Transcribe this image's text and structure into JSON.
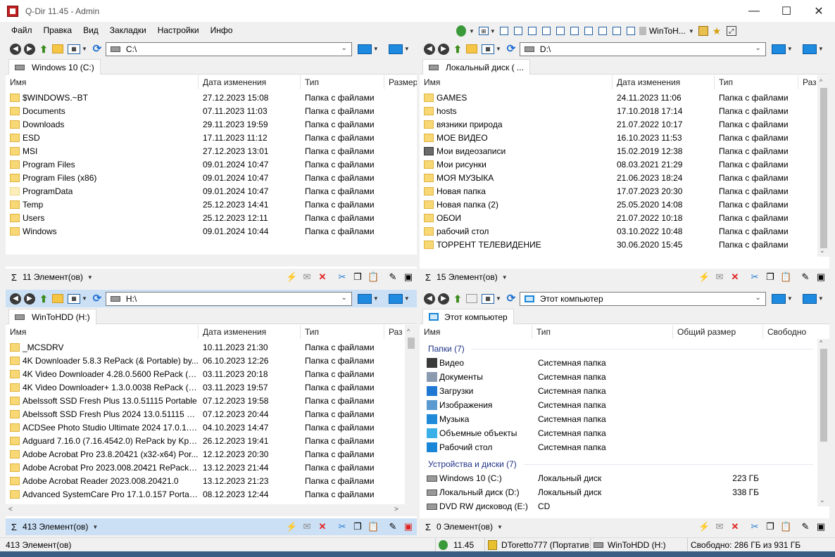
{
  "window": {
    "title": "Q-Dir 11.45 - Admin",
    "minimize": "—",
    "maximize": "☐",
    "close": "✕"
  },
  "menu": [
    "Файл",
    "Правка",
    "Вид",
    "Закладки",
    "Настройки",
    "Инфо"
  ],
  "toolbar_top": {
    "wintohdd_label": "WinToH..."
  },
  "pane_tl": {
    "address": "C:\\",
    "tab": "Windows 10 (C:)",
    "headers": [
      "Имя",
      "Дата изменения",
      "Тип",
      "Размер"
    ],
    "rows": [
      {
        "name": "$WINDOWS.~BT",
        "date": "27.12.2023 15:08",
        "type": "Папка с файлами",
        "pale": false
      },
      {
        "name": "Documents",
        "date": "07.11.2023 11:03",
        "type": "Папка с файлами",
        "pale": false
      },
      {
        "name": "Downloads",
        "date": "29.11.2023 19:59",
        "type": "Папка с файлами",
        "pale": false
      },
      {
        "name": "ESD",
        "date": "17.11.2023 11:12",
        "type": "Папка с файлами",
        "pale": false
      },
      {
        "name": "MSI",
        "date": "27.12.2023 13:01",
        "type": "Папка с файлами",
        "pale": false
      },
      {
        "name": "Program Files",
        "date": "09.01.2024 10:47",
        "type": "Папка с файлами",
        "pale": false
      },
      {
        "name": "Program Files (x86)",
        "date": "09.01.2024 10:47",
        "type": "Папка с файлами",
        "pale": false
      },
      {
        "name": "ProgramData",
        "date": "09.01.2024 10:47",
        "type": "Папка с файлами",
        "pale": true
      },
      {
        "name": "Temp",
        "date": "25.12.2023 14:41",
        "type": "Папка с файлами",
        "pale": false
      },
      {
        "name": "Users",
        "date": "25.12.2023 12:11",
        "type": "Папка с файлами",
        "pale": false
      },
      {
        "name": "Windows",
        "date": "09.01.2024 10:44",
        "type": "Папка с файлами",
        "pale": false
      }
    ],
    "status": "11 Элемент(ов)"
  },
  "pane_tr": {
    "address": "D:\\",
    "tab": "Локальный диск ( ...",
    "headers": [
      "Имя",
      "Дата изменения",
      "Тип",
      "Раз"
    ],
    "rows": [
      {
        "name": "GAMES",
        "date": "24.11.2023 11:06",
        "type": "Папка с файлами",
        "vid": false
      },
      {
        "name": "hosts",
        "date": "17.10.2018 17:14",
        "type": "Папка с файлами",
        "vid": false
      },
      {
        "name": "вязники природа",
        "date": "21.07.2022 10:17",
        "type": "Папка с файлами",
        "vid": false
      },
      {
        "name": "МОЕ ВИДЕО",
        "date": "16.10.2023 11:53",
        "type": "Папка с файлами",
        "vid": false
      },
      {
        "name": "Мои видеозаписи",
        "date": "15.02.2019 12:38",
        "type": "Папка с файлами",
        "vid": true
      },
      {
        "name": "Мои рисунки",
        "date": "08.03.2021 21:29",
        "type": "Папка с файлами",
        "vid": false
      },
      {
        "name": "МОЯ МУЗЫКА",
        "date": "21.06.2023 18:24",
        "type": "Папка с файлами",
        "vid": false
      },
      {
        "name": "Новая папка",
        "date": "17.07.2023 20:30",
        "type": "Папка с файлами",
        "vid": false
      },
      {
        "name": "Новая папка (2)",
        "date": "25.05.2020 14:08",
        "type": "Папка с файлами",
        "vid": false
      },
      {
        "name": "ОБОИ",
        "date": "21.07.2022 10:18",
        "type": "Папка с файлами",
        "vid": false
      },
      {
        "name": "рабочий стол",
        "date": "03.10.2022 10:48",
        "type": "Папка с файлами",
        "vid": false
      },
      {
        "name": "ТОРРЕНТ ТЕЛЕВИДЕНИЕ",
        "date": "30.06.2020 15:45",
        "type": "Папка с файлами",
        "vid": false
      }
    ],
    "status": "15 Элемент(ов)"
  },
  "pane_bl": {
    "address": "H:\\",
    "tab": "WinToHDD (H:)",
    "headers": [
      "Имя",
      "Дата изменения",
      "Тип",
      "Раз"
    ],
    "rows": [
      {
        "name": "_MCSDRV",
        "date": "10.11.2023 21:30",
        "type": "Папка с файлами"
      },
      {
        "name": "4K Downloader 5.8.3 RePack (& Portable) by...",
        "date": "06.10.2023 12:26",
        "type": "Папка с файлами"
      },
      {
        "name": "4K Video Downloader 4.28.0.5600 RePack (&...",
        "date": "03.11.2023 20:18",
        "type": "Папка с файлами"
      },
      {
        "name": "4K Video Downloader+ 1.3.0.0038 RePack (&...",
        "date": "03.11.2023 19:57",
        "type": "Папка с файлами"
      },
      {
        "name": "Abelssoft SSD Fresh Plus 13.0.51115 Portable",
        "date": "07.12.2023 19:58",
        "type": "Папка с файлами"
      },
      {
        "name": "Abelssoft SSD Fresh Plus 2024 13.0.51115 Por...",
        "date": "07.12.2023 20:44",
        "type": "Папка с файлами"
      },
      {
        "name": "ACDSee Photo Studio Ultimate 2024 17.0.1.3...",
        "date": "04.10.2023 14:47",
        "type": "Папка с файлами"
      },
      {
        "name": "Adguard 7.16.0 (7.16.4542.0) RePack by KpoJ...",
        "date": "26.12.2023 19:41",
        "type": "Папка с файлами"
      },
      {
        "name": "Adobe Acrobat Pro 23.8.20421 (x32-x64) Por...",
        "date": "12.12.2023 20:30",
        "type": "Папка с файлами"
      },
      {
        "name": "Adobe Acrobat Pro 2023.008.20421 RePack b...",
        "date": "13.12.2023 21:44",
        "type": "Папка с файлами"
      },
      {
        "name": "Adobe Acrobat Reader 2023.008.20421.0",
        "date": "13.12.2023 21:23",
        "type": "Папка с файлами"
      },
      {
        "name": "Advanced SystemCare Pro 17.1.0.157 Portab...",
        "date": "08.12.2023 12:44",
        "type": "Папка с файлами"
      }
    ],
    "status": "413 Элемент(ов)"
  },
  "pane_br": {
    "address": "Этот компьютер",
    "tab": "Этот компьютер",
    "headers": [
      "Имя",
      "Тип",
      "Общий размер",
      "Свободно"
    ],
    "group1": "Папки (7)",
    "folders": [
      {
        "name": "Видео",
        "type": "Системная папка",
        "icon": "video-folder-icon",
        "color": "#3a3a3a"
      },
      {
        "name": "Документы",
        "type": "Системная папка",
        "icon": "documents-folder-icon",
        "color": "#8a9bb0"
      },
      {
        "name": "Загрузки",
        "type": "Системная папка",
        "icon": "downloads-folder-icon",
        "color": "#1e78d4"
      },
      {
        "name": "Изображения",
        "type": "Системная папка",
        "icon": "pictures-folder-icon",
        "color": "#5a9ad0"
      },
      {
        "name": "Музыка",
        "type": "Системная папка",
        "icon": "music-folder-icon",
        "color": "#1f8ad8"
      },
      {
        "name": "Объемные объекты",
        "type": "Системная папка",
        "icon": "3d-objects-folder-icon",
        "color": "#3ab0e8"
      },
      {
        "name": "Рабочий стол",
        "type": "Системная папка",
        "icon": "desktop-folder-icon",
        "color": "#1a86d8"
      }
    ],
    "group2": "Устройства и диски (7)",
    "drives": [
      {
        "name": "Windows 10 (C:)",
        "type": "Локальный диск",
        "size": "223 ГБ"
      },
      {
        "name": "Локальный диск (D:)",
        "type": "Локальный диск",
        "size": "338 ГБ"
      },
      {
        "name": "DVD RW дисковод (E:)",
        "type": "CD",
        "size": ""
      }
    ],
    "status": "0 Элемент(ов)"
  },
  "statusbar": {
    "items": "413 Элемент(ов)",
    "version": "11.45",
    "user": "DToretto777 (Портатив",
    "drive": "WinToHDD (H:)",
    "free": "Свободно: 286 ГБ из 931 ГБ"
  },
  "colors": {
    "active_pane": "#cce0f5",
    "folder": "#f8d775",
    "group_text": "#1e3287",
    "delete": "#e02020"
  }
}
